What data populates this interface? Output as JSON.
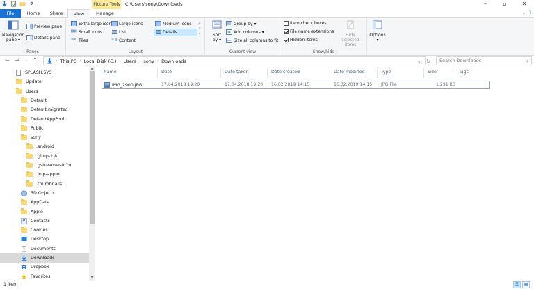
{
  "titlebar": {
    "context_tab": "Picture Tools",
    "path": "C:\\Users\\sony\\Downloads"
  },
  "tabs": {
    "file": "File",
    "home": "Home",
    "share": "Share",
    "view": "View",
    "manage": "Manage"
  },
  "ribbon": {
    "panes": {
      "label": "Panes",
      "navigation_pane": "Navigation",
      "navigation_pane_2": "pane",
      "preview_pane": "Preview pane",
      "details_pane": "Details pane"
    },
    "layout": {
      "label": "Layout",
      "extra_large": "Extra large icons",
      "large": "Large icons",
      "medium": "Medium icons",
      "small": "Small icons",
      "list": "List",
      "details": "Details",
      "tiles": "Tiles",
      "content": "Content"
    },
    "current_view": {
      "label": "Current view",
      "sort_by": "Sort",
      "sort_by_2": "by",
      "group_by": "Group by",
      "add_columns": "Add columns",
      "size_all": "Size all columns to fit"
    },
    "show_hide": {
      "label": "Show/hide",
      "item_check_boxes": "Item check boxes",
      "file_name_extensions": "File name extensions",
      "hidden_items": "Hidden items",
      "hide_selected": "Hide selected",
      "hide_selected_2": "items",
      "item_check_boxes_on": false,
      "file_name_extensions_on": true,
      "hidden_items_on": true
    },
    "options": "Options"
  },
  "address": {
    "crumbs": [
      "This PC",
      "Local Disk (C:)",
      "Users",
      "sony",
      "Downloads"
    ],
    "search_placeholder": "Search Downloads"
  },
  "nav": {
    "items": [
      {
        "label": "SPLASH.SYS",
        "type": "file"
      },
      {
        "label": "Update",
        "type": "folder"
      },
      {
        "label": "Users",
        "type": "folder"
      },
      {
        "label": "Default",
        "type": "folder"
      },
      {
        "label": "Default.migrated",
        "type": "folder"
      },
      {
        "label": "DefaultAppPool",
        "type": "folder"
      },
      {
        "label": "Public",
        "type": "folder"
      },
      {
        "label": "sony",
        "type": "folder"
      },
      {
        "label": ".android",
        "type": "folder"
      },
      {
        "label": ".gimp-2.8",
        "type": "folder"
      },
      {
        "label": ".gstreamer-0.10",
        "type": "folder"
      },
      {
        "label": ".jnlp-applet",
        "type": "folder"
      },
      {
        "label": ".thumbnails",
        "type": "folder"
      },
      {
        "label": "3D Objects",
        "type": "3d"
      },
      {
        "label": "AppData",
        "type": "folder"
      },
      {
        "label": "Apple",
        "type": "folder"
      },
      {
        "label": "Contacts",
        "type": "contacts"
      },
      {
        "label": "Cookies",
        "type": "folder"
      },
      {
        "label": "Desktop",
        "type": "desktop"
      },
      {
        "label": "Documents",
        "type": "documents"
      },
      {
        "label": "Downloads",
        "type": "downloads"
      },
      {
        "label": "Dropbox",
        "type": "dropbox"
      },
      {
        "label": "Favorites",
        "type": "favorites"
      }
    ],
    "selected_index": 20
  },
  "columns": [
    "Name",
    "Date",
    "Date taken",
    "Date created",
    "Date modified",
    "Type",
    "Size",
    "Tags"
  ],
  "files": [
    {
      "name": "IMG_2900.JPG",
      "date": "17.04.2018 19:20",
      "date_taken": "17.04.2018 19:20",
      "date_created": "16.02.2019 14:15",
      "date_modified": "16.02.2019 14:15",
      "type": "JPG File",
      "size": "1,291 KB",
      "tags": ""
    }
  ],
  "status": {
    "items": "1 item"
  },
  "colors": {
    "accent": "#1a73d2",
    "context_tab": "#fdeb9c",
    "folder": "#f8d775",
    "selection": "#cce8ff"
  }
}
